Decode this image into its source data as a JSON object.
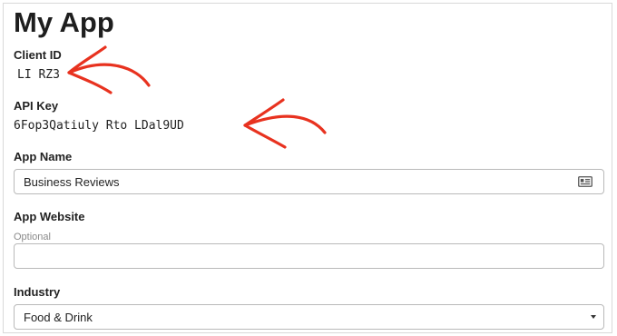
{
  "page": {
    "title": "My App"
  },
  "client_id": {
    "label": "Client ID",
    "value": "LI RZ3"
  },
  "api_key": {
    "label": "API Key",
    "value": "6Fop3Qatiuly Rto LDal9UD"
  },
  "app_name": {
    "label": "App Name",
    "value": "Business Reviews",
    "icon": "contact-card-icon"
  },
  "app_website": {
    "label": "App Website",
    "hint": "Optional",
    "value": ""
  },
  "industry": {
    "label": "Industry",
    "selected": "Food & Drink"
  },
  "annotations": {
    "color": "#e8321f",
    "icon": "hand-drawn-arrow-icon"
  }
}
